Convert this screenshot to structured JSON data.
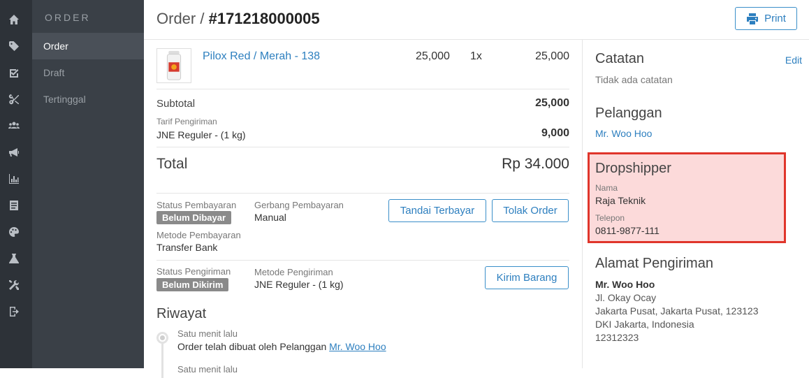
{
  "nav": {
    "icons": [
      "home-icon",
      "tag-icon",
      "checkbox-icon",
      "scissors-icon",
      "users-icon",
      "megaphone-icon",
      "bar-chart-icon",
      "document-icon",
      "palette-icon",
      "flask-icon",
      "tools-icon",
      "sign-out-icon"
    ],
    "heading": "ORDER",
    "items": [
      {
        "label": "Order",
        "active": true
      },
      {
        "label": "Draft",
        "active": false
      },
      {
        "label": "Tertinggal",
        "active": false
      }
    ]
  },
  "header": {
    "title_prefix": "Order /",
    "order_number": "#171218000005",
    "print_label": "Print"
  },
  "product": {
    "name": "Pilox Red / Merah - 138",
    "price": "25,000",
    "qty": "1x",
    "total": "25,000"
  },
  "summary": {
    "subtotal_label": "Subtotal",
    "subtotal_value": "25,000",
    "shipping_caption": "Tarif Pengiriman",
    "shipping_label": "JNE Reguler - (1 kg)",
    "shipping_value": "9,000",
    "total_label": "Total",
    "total_value": "Rp 34.000"
  },
  "payment": {
    "status_label": "Status Pembayaran",
    "status_badge": "Belum Dibayar",
    "gateway_label": "Gerbang Pembayaran",
    "gateway_value": "Manual",
    "method_label": "Metode Pembayaran",
    "method_value": "Transfer Bank",
    "mark_paid_button": "Tandai Terbayar",
    "reject_button": "Tolak Order"
  },
  "shipping": {
    "status_label": "Status Pengiriman",
    "status_badge": "Belum Dikirim",
    "method_label": "Metode Pengiriman",
    "method_value": "JNE Reguler - (1 kg)",
    "send_button": "Kirim Barang"
  },
  "history": {
    "title": "Riwayat",
    "entries": [
      {
        "time": "Satu menit lalu",
        "text": "Order telah dibuat oleh Pelanggan",
        "link": "Mr. Woo Hoo"
      },
      {
        "time": "Satu menit lalu"
      }
    ]
  },
  "notes": {
    "title": "Catatan",
    "edit_label": "Edit",
    "value": "Tidak ada catatan"
  },
  "customer": {
    "title": "Pelanggan",
    "name": "Mr. Woo Hoo"
  },
  "dropshipper": {
    "title": "Dropshipper",
    "name_label": "Nama",
    "name_value": "Raja Teknik",
    "phone_label": "Telepon",
    "phone_value": "0811-9877-111"
  },
  "address": {
    "title": "Alamat Pengiriman",
    "name": "Mr. Woo Hoo",
    "line1": "Jl. Okay Ocay",
    "line2": "Jakarta Pusat, Jakarta Pusat, 123123",
    "line3": "DKI Jakarta, Indonesia",
    "line4": "12312323"
  },
  "colors": {
    "accent": "#2d7fbf",
    "highlight_fill": "#fcdada",
    "highlight_border": "#e0352b"
  }
}
